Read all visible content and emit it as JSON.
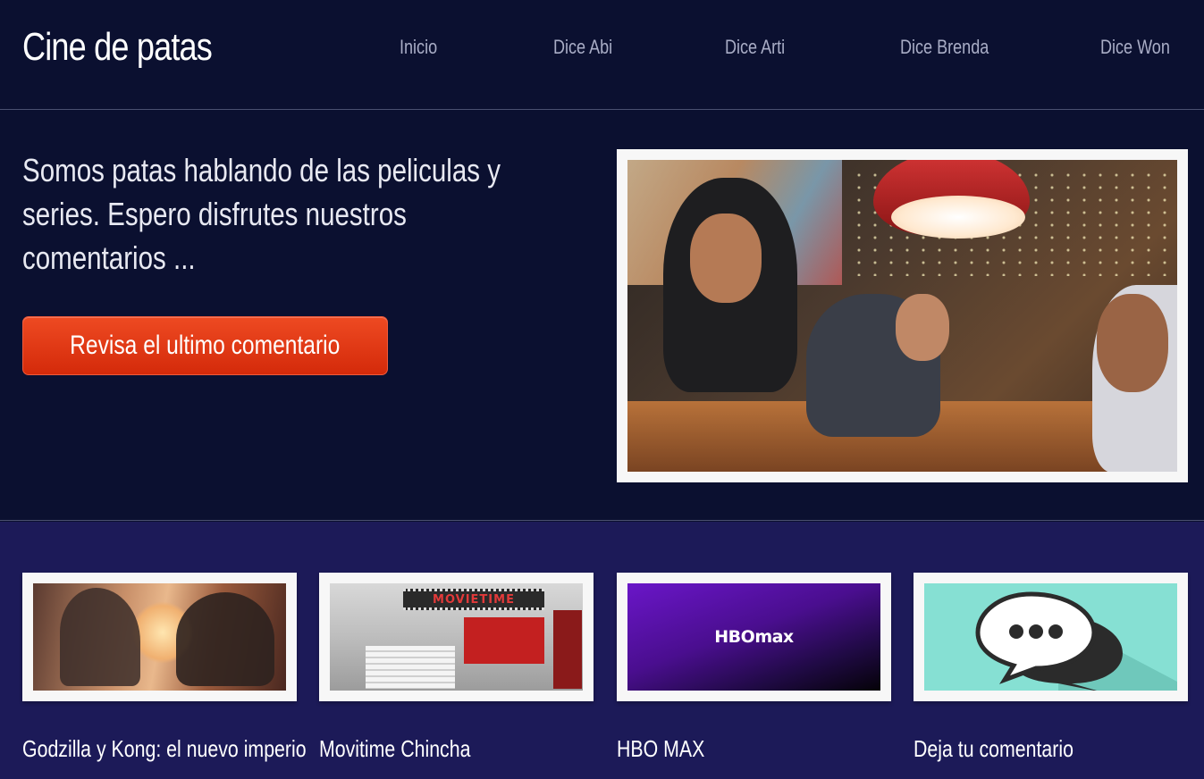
{
  "header": {
    "site_title": "Cine de patas",
    "nav": [
      {
        "label": "Inicio"
      },
      {
        "label": "Dice Abi"
      },
      {
        "label": "Dice Arti"
      },
      {
        "label": "Dice Brenda"
      },
      {
        "label": "Dice Won"
      }
    ]
  },
  "hero": {
    "text": "Somos patas hablando de las peliculas y series. Espero disfrutes nuestros comentarios ...",
    "cta_label": "Revisa el ultimo comentario"
  },
  "features": [
    {
      "title": "Godzilla y Kong: el nuevo imperio"
    },
    {
      "title": "Movitime Chincha",
      "image_text": "MOVIETIME"
    },
    {
      "title": "HBO MAX",
      "image_text": "HBOmax"
    },
    {
      "title": "Deja tu comentario"
    }
  ],
  "colors": {
    "header_bg": "#0b1030",
    "features_bg": "#1c1a58",
    "cta": "#e0321a",
    "nav_text": "#a9adc6"
  }
}
